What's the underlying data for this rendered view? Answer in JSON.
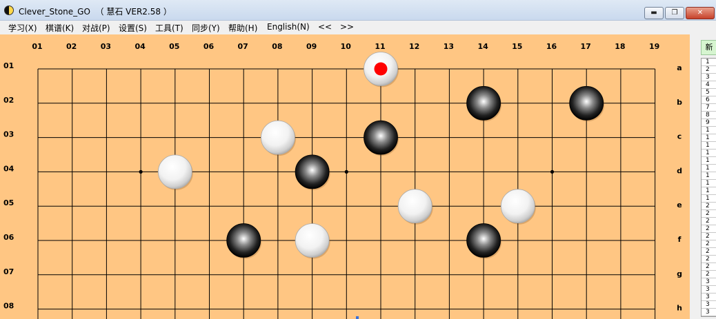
{
  "window": {
    "title": "Clever_Stone_GO  （ 慧石 VER2.58 ）",
    "min_glyph": "▬",
    "max_glyph": "❐",
    "close_glyph": "✕"
  },
  "menu": [
    "学习(X)",
    "棋谱(K)",
    "对战(P)",
    "设置(S)",
    "工具(T)",
    "同步(Y)",
    "帮助(H)",
    "English(N)",
    "<<",
    ">>"
  ],
  "board": {
    "colors": {
      "board": "#ffc683",
      "line": "#000000",
      "last_move_marker": "#ff0000"
    },
    "col_labels": [
      "01",
      "02",
      "03",
      "04",
      "05",
      "06",
      "07",
      "08",
      "09",
      "10",
      "11",
      "12",
      "13",
      "14",
      "15",
      "16",
      "17",
      "18",
      "19"
    ],
    "row_labels": [
      "01",
      "02",
      "03",
      "04",
      "05",
      "06",
      "07",
      "08"
    ],
    "row_letters": [
      "a",
      "b",
      "c",
      "d",
      "e",
      "f",
      "g",
      "h"
    ],
    "star_points": [
      [
        4,
        4
      ],
      [
        10,
        4
      ],
      [
        16,
        4
      ]
    ],
    "stones": [
      {
        "col": 11,
        "row": 1,
        "color": "white",
        "last": true
      },
      {
        "col": 14,
        "row": 2,
        "color": "black"
      },
      {
        "col": 17,
        "row": 2,
        "color": "black"
      },
      {
        "col": 8,
        "row": 3,
        "color": "white"
      },
      {
        "col": 11,
        "row": 3,
        "color": "black"
      },
      {
        "col": 5,
        "row": 4,
        "color": "white"
      },
      {
        "col": 9,
        "row": 4,
        "color": "black"
      },
      {
        "col": 12,
        "row": 5,
        "color": "white"
      },
      {
        "col": 15,
        "row": 5,
        "color": "white"
      },
      {
        "col": 7,
        "row": 6,
        "color": "black"
      },
      {
        "col": 9,
        "row": 6,
        "color": "white"
      },
      {
        "col": 14,
        "row": 6,
        "color": "black"
      }
    ]
  },
  "right_panel": {
    "tab_label": "新",
    "list_items": [
      "1",
      "2",
      "3",
      "4",
      "5",
      "6",
      "7",
      "8",
      "9",
      "1",
      "1",
      "1",
      "1",
      "1",
      "1",
      "1",
      "1",
      "1",
      "1",
      "2",
      "2",
      "2",
      "2",
      "2",
      "2",
      "2",
      "2",
      "2",
      "2",
      "3",
      "3",
      "3",
      "3",
      "3"
    ]
  }
}
